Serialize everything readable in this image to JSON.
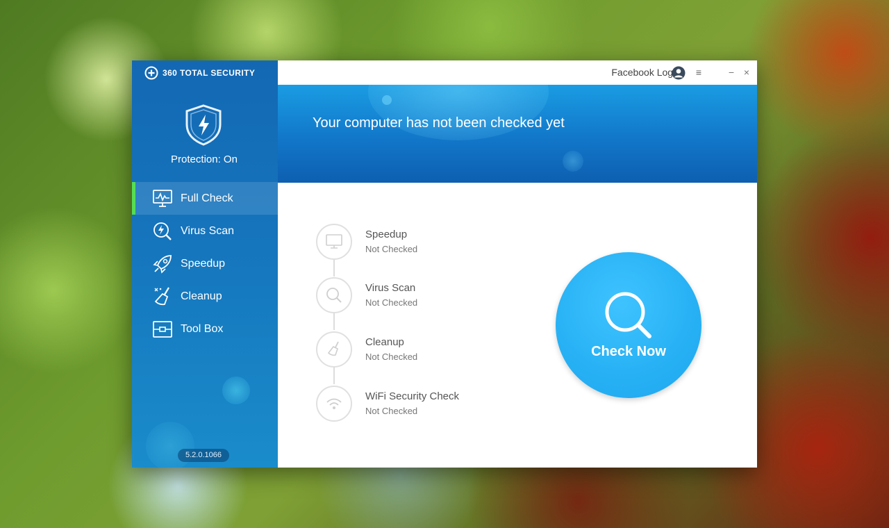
{
  "app": {
    "brand": "360 TOTAL SECURITY",
    "version": "5.2.0.1066"
  },
  "sidebar": {
    "protection_status": "Protection: On",
    "items": [
      {
        "label": "Full Check",
        "icon": "monitor-chart-icon",
        "active": true
      },
      {
        "label": "Virus Scan",
        "icon": "lightning-search-icon",
        "active": false
      },
      {
        "label": "Speedup",
        "icon": "rocket-icon",
        "active": false
      },
      {
        "label": "Cleanup",
        "icon": "broom-icon",
        "active": false
      },
      {
        "label": "Tool Box",
        "icon": "toolbox-icon",
        "active": false
      }
    ]
  },
  "titlebar": {
    "login_label": "Facebook Login",
    "menu_icon": "≡",
    "minimize_icon": "−",
    "close_icon": "×"
  },
  "banner": {
    "message": "Your computer has not been checked yet"
  },
  "checks": [
    {
      "name": "Speedup",
      "status": "Not Checked",
      "icon": "monitor-icon"
    },
    {
      "name": "Virus Scan",
      "status": "Not Checked",
      "icon": "search-icon"
    },
    {
      "name": "Cleanup",
      "status": "Not Checked",
      "icon": "broom-icon"
    },
    {
      "name": "WiFi Security Check",
      "status": "Not Checked",
      "icon": "wifi-icon"
    }
  ],
  "action": {
    "check_now_label": "Check Now"
  },
  "colors": {
    "sidebar": "#1575bd",
    "active_indicator": "#55dd55",
    "check_now": "#28b2f5",
    "banner": "#1277c9"
  }
}
